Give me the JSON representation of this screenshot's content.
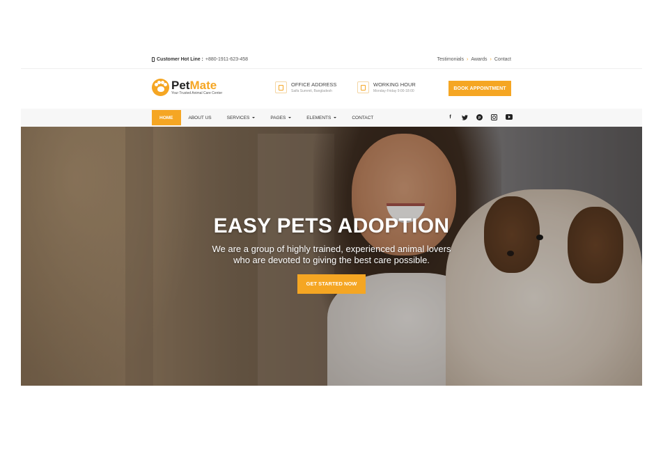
{
  "topbar": {
    "hotline_label": "Customer Hot Line :",
    "hotline_number": "+880-1911-623-458",
    "links": [
      "Testimonials",
      "Awards",
      "Contact"
    ]
  },
  "header": {
    "logo_pet": "Pet",
    "logo_mate": "Mate",
    "logo_tagline": "Your Trusted Animal Care Center",
    "office": {
      "title": "OFFICE ADDRESS",
      "value": "Saifa Summit, Bangladesh"
    },
    "hours": {
      "title": "WORKING HOUR",
      "value": "Monday-Friday 9:00-18:00"
    },
    "book_label": "BOOK APPOINTMENT"
  },
  "nav": {
    "items": [
      {
        "label": "HOME",
        "active": true
      },
      {
        "label": "ABOUT US"
      },
      {
        "label": "SERVICES",
        "dropdown": true
      },
      {
        "label": "PAGES",
        "dropdown": true
      },
      {
        "label": "ELEMENTS",
        "dropdown": true
      },
      {
        "label": "CONTACT"
      }
    ],
    "social_icons": [
      "facebook-icon",
      "twitter-icon",
      "pinterest-icon",
      "instagram-icon",
      "youtube-icon"
    ]
  },
  "hero": {
    "title": "EASY PETS ADOPTION",
    "subtitle_line1": "We are a group of highly trained, experienced animal lovers",
    "subtitle_line2": "who are devoted to giving the best care possible.",
    "cta_label": "GET STARTED NOW"
  },
  "colors": {
    "accent": "#f5a623",
    "nav_bg": "#f7f7f7"
  }
}
